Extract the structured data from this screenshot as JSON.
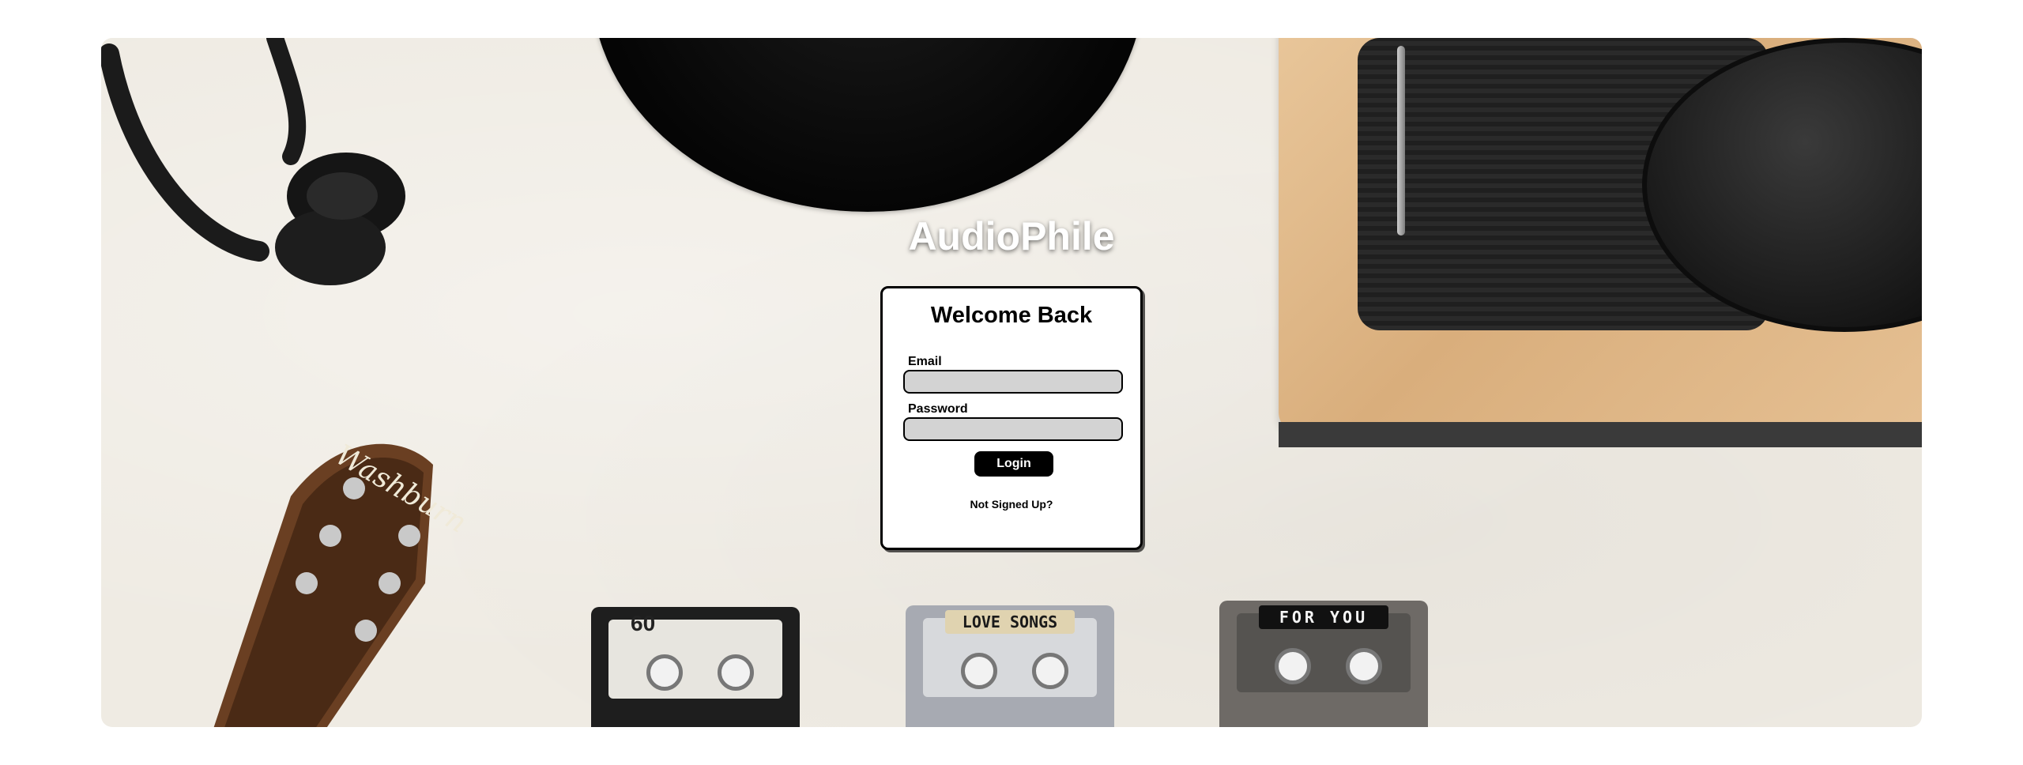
{
  "brand": {
    "title": "AudioPhile"
  },
  "login": {
    "heading": "Welcome Back",
    "email_label": "Email",
    "email_value": "",
    "password_label": "Password",
    "password_value": "",
    "button_label": "Login",
    "signup_link": "Not Signed Up?"
  },
  "background": {
    "cassette_1_label": "60",
    "cassette_2_label": "LOVE SONGS",
    "cassette_3_label": "FOR YOU",
    "guitar_brand": "Washburn"
  },
  "colors": {
    "page_background": "#ffffff",
    "backdrop": "#efebe3",
    "button": "#000000",
    "input_fill": "#d3d3d3"
  }
}
